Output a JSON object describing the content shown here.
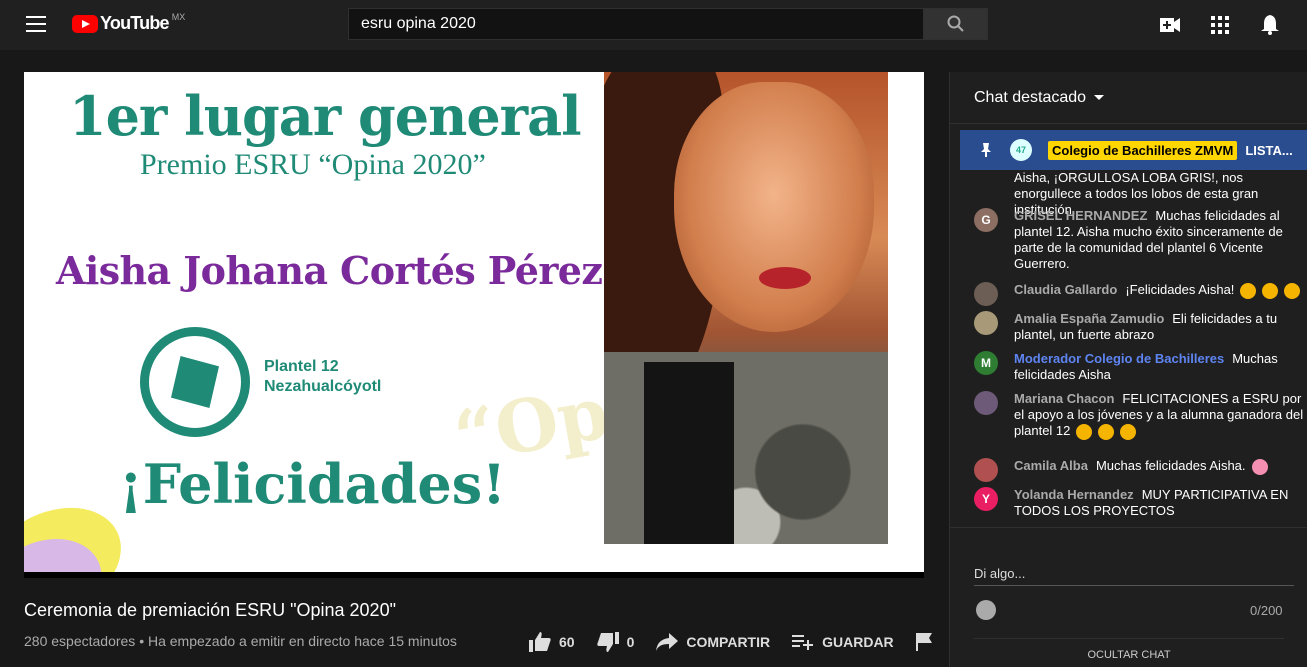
{
  "header": {
    "logo_text": "YouTube",
    "country": "MX",
    "search_value": "esru opina 2020"
  },
  "slide": {
    "title": "1er lugar general",
    "subtitle": "Premio ESRU “Opina 2020”",
    "name": "Aisha Johana Cortés Pérez",
    "plantel_line1": "Plantel 12",
    "plantel_line2": "Nezahualcóyotl",
    "congrats": "¡Felicidades!",
    "deco": "“Op"
  },
  "video": {
    "title": "Ceremonia de premiación ESRU \"Opina 2020\"",
    "meta": "280 espectadores • Ha empezado a emitir en directo hace 15 minutos",
    "likes": "60",
    "dislikes": "0",
    "share_label": "COMPARTIR",
    "save_label": "GUARDAR"
  },
  "chat": {
    "header": "Chat destacado",
    "pinned": {
      "author": "Colegio de Bachilleres ZMVM",
      "text": "LISTA...",
      "avatar_text": "47"
    },
    "messages": [
      {
        "author": "",
        "text": "Aisha, ¡ORGULLOSA LOBA GRIS!, nos enorgullece a todos los lobos de esta gran institución.",
        "avatar": "",
        "color": "#555555"
      },
      {
        "author": "GRISEL HERNANDEZ",
        "text": "Muchas felicidades al plantel 12. Aisha mucho éxito sinceramente de parte de la comunidad del plantel 6 Vicente Guerrero.",
        "avatar": "G",
        "color": "#8d6e63"
      },
      {
        "author": "Claudia Gallardo",
        "text": "¡Felicidades Aisha!",
        "avatar": "",
        "color": "#6d5e55"
      },
      {
        "author": "Amalia España Zamudio",
        "text": "Eli felicidades a tu plantel, un fuerte abrazo",
        "avatar": "",
        "color": "#a89a78"
      },
      {
        "author": "Moderador Colegio de Bachilleres",
        "text": "Muchas felicidades Aisha",
        "avatar": "M",
        "color": "#2e7d32"
      },
      {
        "author": "Mariana Chacon",
        "text": "FELICITACIONES a ESRU por el apoyo a los jóvenes y a la alumna ganadora del plantel 12",
        "avatar": "",
        "color": "#6c5a78"
      },
      {
        "author": "Camila Alba",
        "text": "Muchas felicidades Aisha.",
        "avatar": "",
        "color": "#b05050"
      },
      {
        "author": "Yolanda Hernandez",
        "text": "MUY PARTICIPATIVA EN TODOS LOS PROYECTOS",
        "avatar": "Y",
        "color": "#e91e63"
      }
    ],
    "input_placeholder": "Di algo...",
    "counter": "0/200",
    "hide_label": "OCULTAR CHAT"
  }
}
